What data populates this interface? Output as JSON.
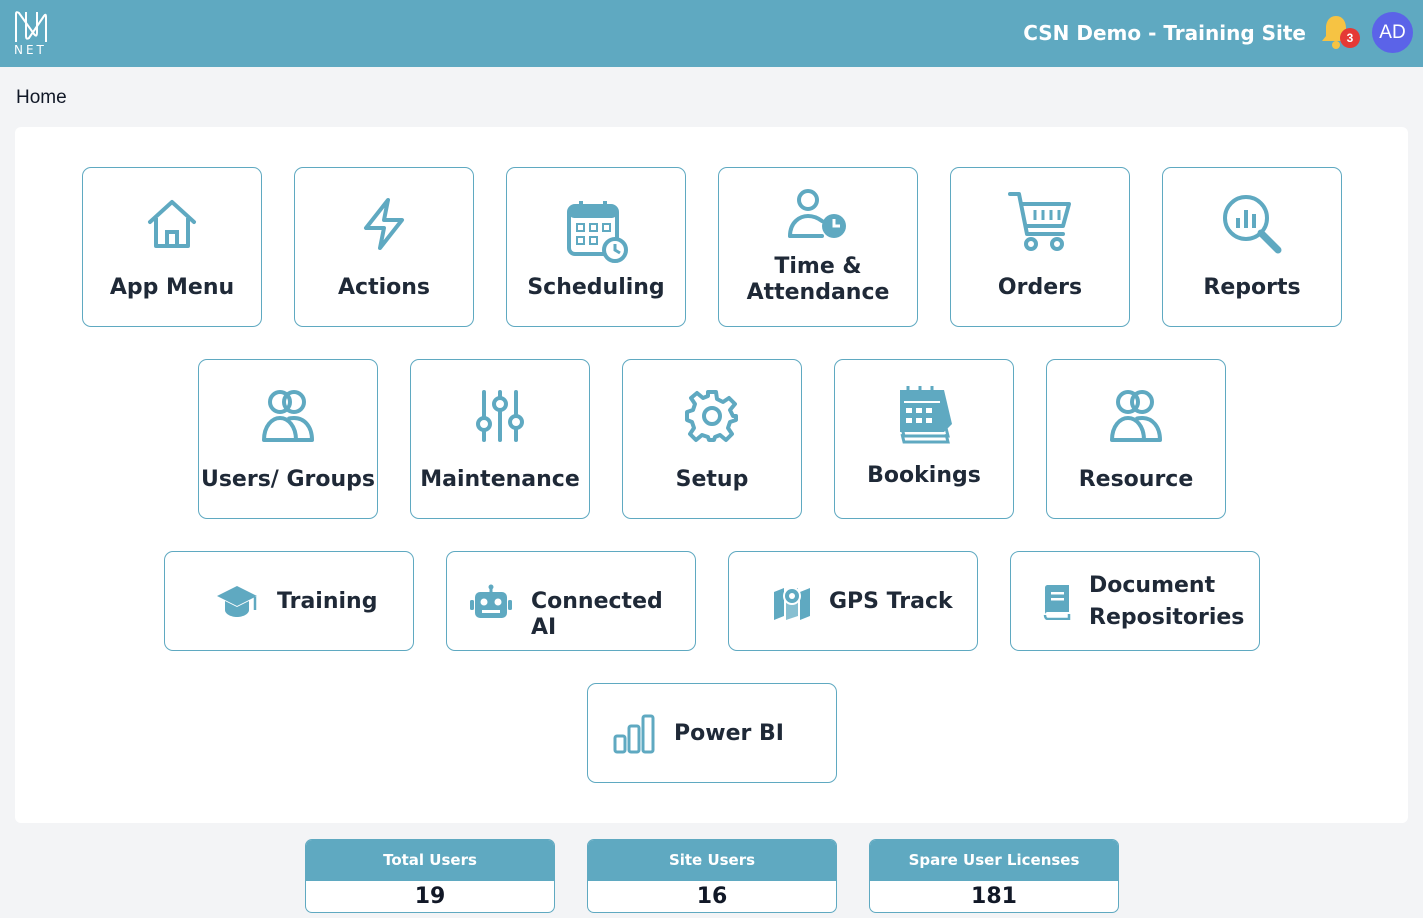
{
  "header": {
    "logo_text": "NET",
    "site_title": "CSN Demo - Training Site",
    "notification_count": "3",
    "avatar_initials": "AD",
    "accent_color": "#5fa9c1"
  },
  "breadcrumb": {
    "current": "Home"
  },
  "tiles": [
    {
      "label": "App Menu",
      "icon": "home-icon"
    },
    {
      "label": "Actions",
      "icon": "lightning-icon"
    },
    {
      "label": "Scheduling",
      "icon": "calendar-clock-icon"
    },
    {
      "label": "Time &",
      "label2": "Attendance",
      "icon": "user-clock-icon"
    },
    {
      "label": "Orders",
      "icon": "cart-icon"
    },
    {
      "label": "Reports",
      "icon": "magnifier-chart-icon"
    },
    {
      "label": "Users/ Groups",
      "icon": "users-icon"
    },
    {
      "label": "Maintenance",
      "icon": "sliders-icon"
    },
    {
      "label": "Setup",
      "icon": "gear-icon"
    },
    {
      "label": "Bookings",
      "icon": "calendar-stack-icon"
    },
    {
      "label": "Resource",
      "icon": "users-icon"
    },
    {
      "label": "Training",
      "icon": "graduation-cap-icon"
    },
    {
      "label": "Connected AI",
      "icon": "robot-icon"
    },
    {
      "label": "GPS Track",
      "icon": "map-pin-icon"
    },
    {
      "label": "Document",
      "label2": "Repositories",
      "icon": "book-icon"
    },
    {
      "label": "Power BI",
      "icon": "bar-chart-icon"
    }
  ],
  "stats": [
    {
      "label": "Total Users",
      "value": "19"
    },
    {
      "label": "Site Users",
      "value": "16"
    },
    {
      "label": "Spare User Licenses",
      "value": "181"
    }
  ]
}
